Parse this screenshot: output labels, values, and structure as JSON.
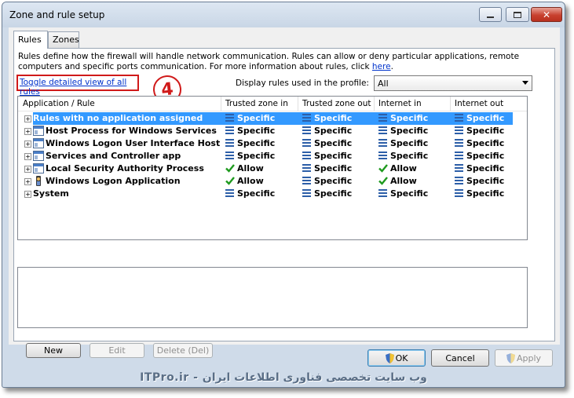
{
  "window": {
    "title": "Zone and rule setup"
  },
  "tabs": [
    {
      "label": "Rules",
      "active": true
    },
    {
      "label": "Zones",
      "active": false
    }
  ],
  "description": {
    "text": "Rules define how the firewall will handle network communication. Rules can allow or deny particular applications, remote computers and specific ports communication. For more information about rules, click ",
    "link": "here",
    "end": "."
  },
  "toggle_link": "Toggle detailed view of all rules",
  "step_marker": "4",
  "profile": {
    "label": "Display rules used in the profile:",
    "selected": "All"
  },
  "grid": {
    "columns": [
      "Application / Rule",
      "Trusted zone in",
      "Trusted zone out",
      "Internet in",
      "Internet out"
    ],
    "rows": [
      {
        "name": "Rules with no application assigned",
        "icon": "none",
        "selected": true,
        "cells": [
          {
            "label": "Specific",
            "icon": "rules-icon"
          },
          {
            "label": "Specific",
            "icon": "rules-icon"
          },
          {
            "label": "Specific",
            "icon": "rules-icon"
          },
          {
            "label": "Specific",
            "icon": "rules-icon"
          }
        ]
      },
      {
        "name": "Host Process for Windows Services",
        "icon": "window-app-icon",
        "selected": false,
        "cells": [
          {
            "label": "Specific",
            "icon": "rules-icon"
          },
          {
            "label": "Specific",
            "icon": "rules-icon"
          },
          {
            "label": "Specific",
            "icon": "rules-icon"
          },
          {
            "label": "Specific",
            "icon": "rules-icon"
          }
        ]
      },
      {
        "name": "Windows Logon User Interface Host",
        "icon": "window-app-icon",
        "selected": false,
        "cells": [
          {
            "label": "Specific",
            "icon": "rules-icon"
          },
          {
            "label": "Specific",
            "icon": "rules-icon"
          },
          {
            "label": "Specific",
            "icon": "rules-icon"
          },
          {
            "label": "Specific",
            "icon": "rules-icon"
          }
        ]
      },
      {
        "name": "Services and Controller app",
        "icon": "window-app-icon",
        "selected": false,
        "cells": [
          {
            "label": "Specific",
            "icon": "rules-icon"
          },
          {
            "label": "Specific",
            "icon": "rules-icon"
          },
          {
            "label": "Specific",
            "icon": "rules-icon"
          },
          {
            "label": "Specific",
            "icon": "rules-icon"
          }
        ]
      },
      {
        "name": "Local Security Authority Process",
        "icon": "window-app-icon",
        "selected": false,
        "cells": [
          {
            "label": "Allow",
            "icon": "check-icon"
          },
          {
            "label": "Specific",
            "icon": "rules-icon"
          },
          {
            "label": "Allow",
            "icon": "check-icon"
          },
          {
            "label": "Specific",
            "icon": "rules-icon"
          }
        ]
      },
      {
        "name": "Windows Logon Application",
        "icon": "logon-app-icon",
        "selected": false,
        "cells": [
          {
            "label": "Allow",
            "icon": "check-icon"
          },
          {
            "label": "Specific",
            "icon": "rules-icon"
          },
          {
            "label": "Allow",
            "icon": "check-icon"
          },
          {
            "label": "Specific",
            "icon": "rules-icon"
          }
        ]
      },
      {
        "name": "System",
        "icon": "none",
        "selected": false,
        "cells": [
          {
            "label": "Specific",
            "icon": "rules-icon"
          },
          {
            "label": "Specific",
            "icon": "rules-icon"
          },
          {
            "label": "Specific",
            "icon": "rules-icon"
          },
          {
            "label": "Specific",
            "icon": "rules-icon"
          }
        ]
      }
    ]
  },
  "buttons": {
    "new": "New",
    "edit": "Edit",
    "delete": "Delete (Del)",
    "ok": "OK",
    "cancel": "Cancel",
    "apply": "Apply"
  },
  "watermark": "ITPro.ir - وب سایت تخصصی فناوری اطلاعات ایران",
  "colors": {
    "selection": "#3399ff",
    "link": "#0033cc",
    "annotation": "#d01a1a",
    "allow": "#1e9a1e",
    "specific": "#2d5fa8"
  }
}
